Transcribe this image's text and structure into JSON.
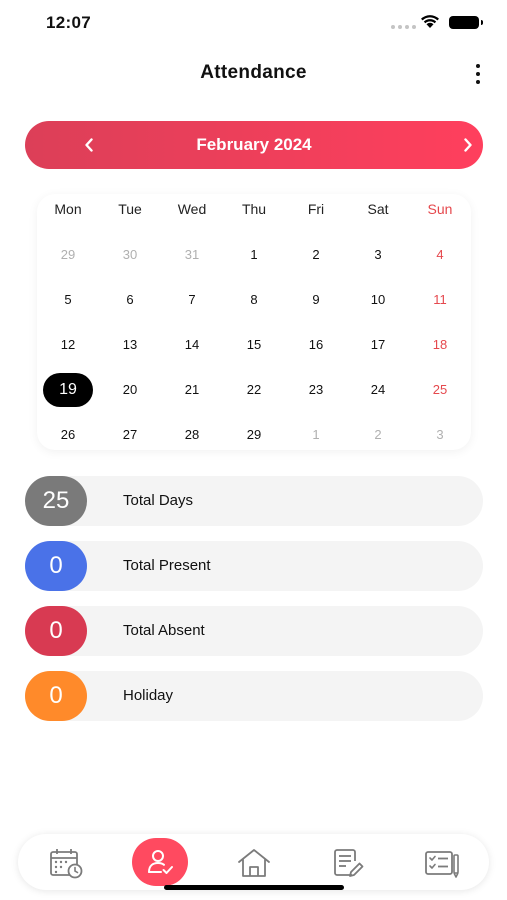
{
  "status_bar": {
    "time": "12:07"
  },
  "header": {
    "title": "Attendance"
  },
  "calendar": {
    "month_label": "February 2024",
    "weekdays": [
      "Mon",
      "Tue",
      "Wed",
      "Thu",
      "Fri",
      "Sat",
      "Sun"
    ],
    "weeks": [
      [
        "29",
        "30",
        "31",
        "1",
        "2",
        "3",
        "4"
      ],
      [
        "5",
        "6",
        "7",
        "8",
        "9",
        "10",
        "11"
      ],
      [
        "12",
        "13",
        "14",
        "15",
        "16",
        "17",
        "18"
      ],
      [
        "19",
        "20",
        "21",
        "22",
        "23",
        "24",
        "25"
      ],
      [
        "26",
        "27",
        "28",
        "29",
        "1",
        "2",
        "3"
      ]
    ],
    "selected_day": "19"
  },
  "stats": [
    {
      "value": "25",
      "label": "Total Days",
      "color": "#7a7a7a"
    },
    {
      "value": "0",
      "label": "Total Present",
      "color": "#4a72e8"
    },
    {
      "value": "0",
      "label": "Total Absent",
      "color": "#d83a52"
    },
    {
      "value": "0",
      "label": "Holiday",
      "color": "#ff8a2a"
    }
  ],
  "bottom_nav": {
    "items": [
      {
        "icon": "calendar-clock-icon"
      },
      {
        "icon": "user-check-icon",
        "active": true
      },
      {
        "icon": "home-icon"
      },
      {
        "icon": "document-edit-icon"
      },
      {
        "icon": "checklist-icon"
      }
    ]
  },
  "colors": {
    "accent": "#ff3f5d",
    "accent_dark": "#dc3f58",
    "sunday": "#e5484d"
  }
}
